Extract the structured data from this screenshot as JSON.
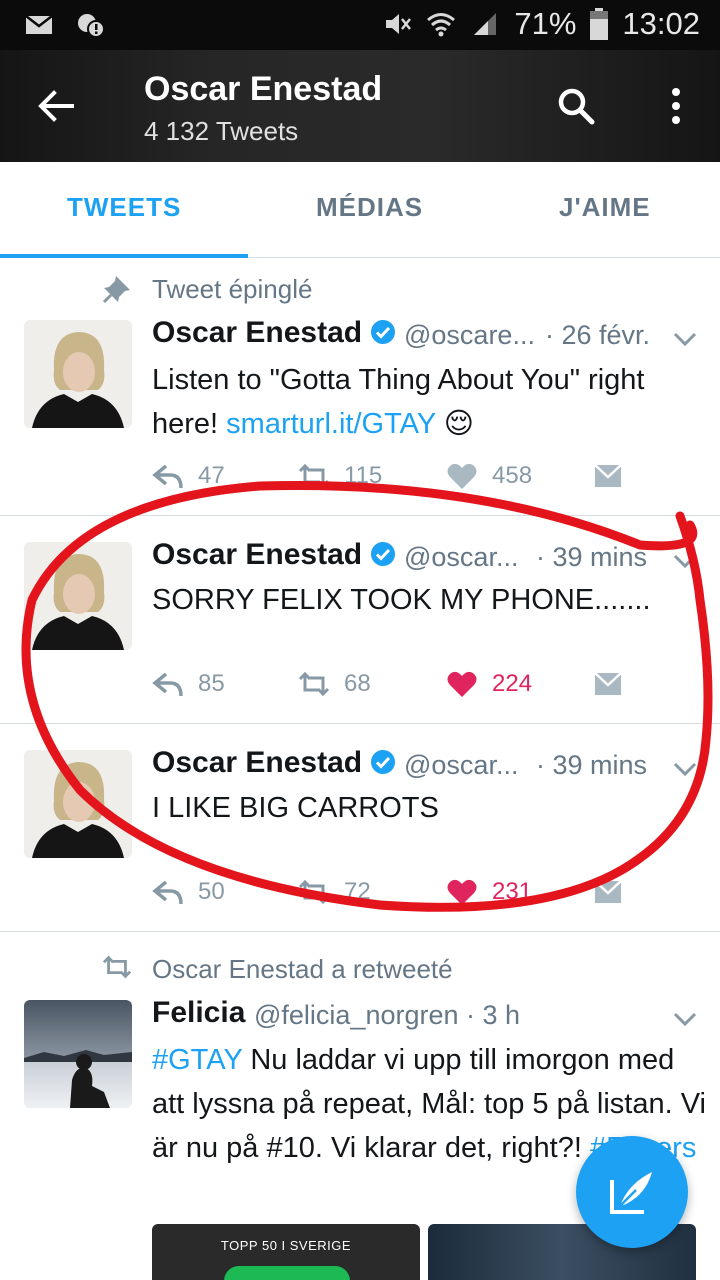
{
  "status_bar": {
    "battery": "71%",
    "time": "13:02",
    "icons": [
      "mail-icon",
      "notification-icon",
      "mute-icon",
      "wifi-icon",
      "signal-icon",
      "battery-icon"
    ]
  },
  "header": {
    "title": "Oscar Enestad",
    "subtitle": "4 132 Tweets"
  },
  "tabs": [
    {
      "label": "TWEETS",
      "active": true
    },
    {
      "label": "MÉDIAS",
      "active": false
    },
    {
      "label": "J'AIME",
      "active": false
    }
  ],
  "tweets": [
    {
      "context": "Tweet épinglé",
      "name": "Oscar Enestad",
      "handle": "@oscare...",
      "time": "· 26 févr.",
      "text_before": "Listen to \"Gotta Thing About You\" right here! ",
      "link": "smarturl.it/GTAY",
      "emoji": "😌",
      "replies": "47",
      "retweets": "115",
      "likes": "458",
      "liked": false
    },
    {
      "name": "Oscar Enestad",
      "handle": "@oscar...",
      "time": "· 39 mins",
      "text": "SORRY FELIX TOOK MY PHONE.......",
      "replies": "85",
      "retweets": "68",
      "likes": "224",
      "liked": true
    },
    {
      "name": "Oscar Enestad",
      "handle": "@oscar...",
      "time": "· 39 mins",
      "text": "I LIKE BIG CARROTS",
      "replies": "50",
      "retweets": "72",
      "likes": "231",
      "liked": true
    },
    {
      "context": "Oscar Enestad a retweeté",
      "name": "Felicia",
      "handle": "@felicia_norgren",
      "time": "· 3 h",
      "hashtag1": "#GTAY",
      "text_middle": " Nu laddar vi upp till imorgon med att lyssna på repeat, Mål: top 5 på listan. Vi är nu på #10. Vi klarar det, right?! ",
      "hashtag2": "#Fooers",
      "media_label": "TOPP 50 I SVERIGE"
    }
  ],
  "colors": {
    "accent": "#1da1f2",
    "like": "#e0245e",
    "annotation": "#e4141c"
  }
}
